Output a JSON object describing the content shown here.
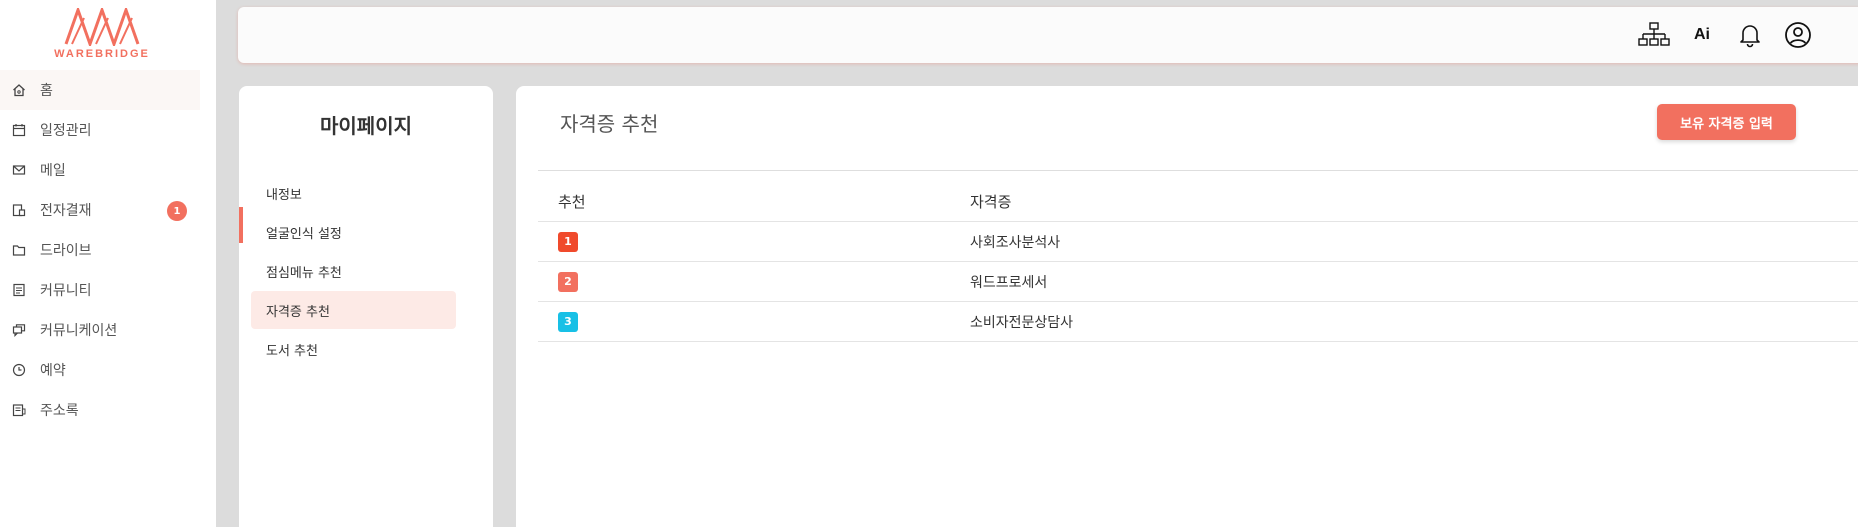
{
  "brand": {
    "logo_text": "WAREBRIDGE",
    "color": "#f2705f"
  },
  "sidebar": {
    "items": [
      {
        "label": "홈",
        "icon": "home-icon",
        "active": true
      },
      {
        "label": "일정관리",
        "icon": "calendar-icon"
      },
      {
        "label": "메일",
        "icon": "mail-icon"
      },
      {
        "label": "전자결재",
        "icon": "approval-icon",
        "badge": "1"
      },
      {
        "label": "드라이브",
        "icon": "folder-icon"
      },
      {
        "label": "커뮤니티",
        "icon": "board-icon"
      },
      {
        "label": "커뮤니케이션",
        "icon": "chat-icon"
      },
      {
        "label": "예약",
        "icon": "clock-icon"
      },
      {
        "label": "주소록",
        "icon": "address-book-icon"
      }
    ]
  },
  "header": {
    "icons": [
      "org-chart-icon",
      "ai-icon",
      "bell-icon",
      "user-icon"
    ],
    "ai_label": "Ai"
  },
  "mypage": {
    "title": "마이페이지",
    "menu": [
      {
        "label": "내정보"
      },
      {
        "label": "얼굴인식 설정"
      },
      {
        "label": "점심메뉴 추천"
      },
      {
        "label": "자격증 추천",
        "active": true
      },
      {
        "label": "도서 추천"
      }
    ]
  },
  "main": {
    "title": "자격증 추천",
    "add_button_label": "보유 자격증 입력",
    "table": {
      "headers": [
        "추천",
        "자격증"
      ],
      "rows": [
        {
          "rank": "1",
          "rank_color": "#f04a2c",
          "cert": "사회조사분석사"
        },
        {
          "rank": "2",
          "rank_color": "#f2705f",
          "cert": "워드프로세서"
        },
        {
          "rank": "3",
          "rank_color": "#18c0e6",
          "cert": "소비자전문상담사"
        }
      ]
    }
  }
}
